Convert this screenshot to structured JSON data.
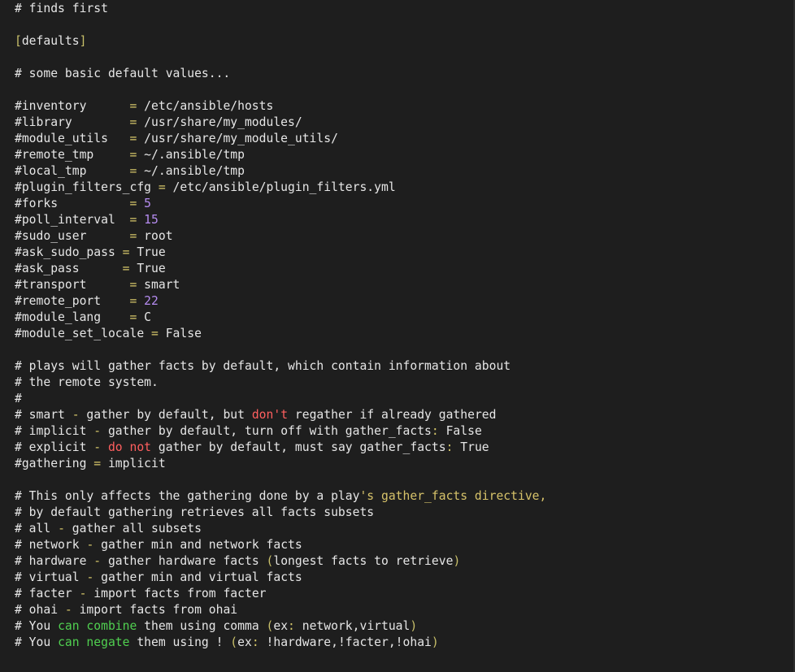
{
  "colors": {
    "background": "#1e1e1e",
    "text": "#e6e6e6",
    "bracket": "#c9c06a",
    "operator": "#d6c76a",
    "number": "#b58cf0",
    "keyword": "#ff5f5f",
    "string": "#d7c36a",
    "green": "#50d050"
  },
  "lines": [
    [
      {
        "t": "# finds first",
        "c": "text"
      }
    ],
    [],
    [
      {
        "t": "[",
        "c": "bracket"
      },
      {
        "t": "defaults",
        "c": "text"
      },
      {
        "t": "]",
        "c": "bracket"
      }
    ],
    [],
    [
      {
        "t": "# some basic default values...",
        "c": "text"
      }
    ],
    [],
    [
      {
        "t": "#inventory      ",
        "c": "text"
      },
      {
        "t": "=",
        "c": "operator"
      },
      {
        "t": " /etc/ansible/hosts",
        "c": "text"
      }
    ],
    [
      {
        "t": "#library        ",
        "c": "text"
      },
      {
        "t": "=",
        "c": "operator"
      },
      {
        "t": " /usr/share/my_modules/",
        "c": "text"
      }
    ],
    [
      {
        "t": "#module_utils   ",
        "c": "text"
      },
      {
        "t": "=",
        "c": "operator"
      },
      {
        "t": " /usr/share/my_module_utils/",
        "c": "text"
      }
    ],
    [
      {
        "t": "#remote_tmp     ",
        "c": "text"
      },
      {
        "t": "=",
        "c": "operator"
      },
      {
        "t": " ~/.ansible/tmp",
        "c": "text"
      }
    ],
    [
      {
        "t": "#local_tmp      ",
        "c": "text"
      },
      {
        "t": "=",
        "c": "operator"
      },
      {
        "t": " ~/.ansible/tmp",
        "c": "text"
      }
    ],
    [
      {
        "t": "#plugin_filters_cfg ",
        "c": "text"
      },
      {
        "t": "=",
        "c": "operator"
      },
      {
        "t": " /etc/ansible/plugin_filters.yml",
        "c": "text"
      }
    ],
    [
      {
        "t": "#forks          ",
        "c": "text"
      },
      {
        "t": "=",
        "c": "operator"
      },
      {
        "t": " ",
        "c": "text"
      },
      {
        "t": "5",
        "c": "number"
      }
    ],
    [
      {
        "t": "#poll_interval  ",
        "c": "text"
      },
      {
        "t": "=",
        "c": "operator"
      },
      {
        "t": " ",
        "c": "text"
      },
      {
        "t": "15",
        "c": "number"
      }
    ],
    [
      {
        "t": "#sudo_user      ",
        "c": "text"
      },
      {
        "t": "=",
        "c": "operator"
      },
      {
        "t": " root",
        "c": "text"
      }
    ],
    [
      {
        "t": "#ask_sudo_pass ",
        "c": "text"
      },
      {
        "t": "=",
        "c": "operator"
      },
      {
        "t": " True",
        "c": "text"
      }
    ],
    [
      {
        "t": "#ask_pass      ",
        "c": "text"
      },
      {
        "t": "=",
        "c": "operator"
      },
      {
        "t": " True",
        "c": "text"
      }
    ],
    [
      {
        "t": "#transport      ",
        "c": "text"
      },
      {
        "t": "=",
        "c": "operator"
      },
      {
        "t": " smart",
        "c": "text"
      }
    ],
    [
      {
        "t": "#remote_port    ",
        "c": "text"
      },
      {
        "t": "=",
        "c": "operator"
      },
      {
        "t": " ",
        "c": "text"
      },
      {
        "t": "22",
        "c": "number"
      }
    ],
    [
      {
        "t": "#module_lang    ",
        "c": "text"
      },
      {
        "t": "=",
        "c": "operator"
      },
      {
        "t": " C",
        "c": "text"
      }
    ],
    [
      {
        "t": "#module_set_locale ",
        "c": "text"
      },
      {
        "t": "=",
        "c": "operator"
      },
      {
        "t": " False",
        "c": "text"
      }
    ],
    [],
    [
      {
        "t": "# plays will gather facts by default, which contain information about",
        "c": "text"
      }
    ],
    [
      {
        "t": "# the remote system.",
        "c": "text"
      }
    ],
    [
      {
        "t": "#",
        "c": "text"
      }
    ],
    [
      {
        "t": "# smart ",
        "c": "text"
      },
      {
        "t": "-",
        "c": "operator"
      },
      {
        "t": " gather by default, but ",
        "c": "text"
      },
      {
        "t": "don't",
        "c": "keyword"
      },
      {
        "t": " regather if already gathered",
        "c": "text"
      }
    ],
    [
      {
        "t": "# implicit ",
        "c": "text"
      },
      {
        "t": "-",
        "c": "operator"
      },
      {
        "t": " gather by default, turn off with gather_facts",
        "c": "text"
      },
      {
        "t": ":",
        "c": "operator"
      },
      {
        "t": " False",
        "c": "text"
      }
    ],
    [
      {
        "t": "# explicit ",
        "c": "text"
      },
      {
        "t": "-",
        "c": "operator"
      },
      {
        "t": " ",
        "c": "text"
      },
      {
        "t": "do not",
        "c": "keyword"
      },
      {
        "t": " gather by default, must say gather_facts",
        "c": "text"
      },
      {
        "t": ":",
        "c": "operator"
      },
      {
        "t": " True",
        "c": "text"
      }
    ],
    [
      {
        "t": "#gathering ",
        "c": "text"
      },
      {
        "t": "=",
        "c": "operator"
      },
      {
        "t": " implicit",
        "c": "text"
      }
    ],
    [],
    [
      {
        "t": "# This only affects the gathering done by a play",
        "c": "text"
      },
      {
        "t": "'s gather_facts directive,",
        "c": "string"
      }
    ],
    [
      {
        "t": "# by default gathering retrieves all facts subsets",
        "c": "text"
      }
    ],
    [
      {
        "t": "# all ",
        "c": "text"
      },
      {
        "t": "-",
        "c": "operator"
      },
      {
        "t": " gather all subsets",
        "c": "text"
      }
    ],
    [
      {
        "t": "# network ",
        "c": "text"
      },
      {
        "t": "-",
        "c": "operator"
      },
      {
        "t": " gather min and network facts",
        "c": "text"
      }
    ],
    [
      {
        "t": "# hardware ",
        "c": "text"
      },
      {
        "t": "-",
        "c": "operator"
      },
      {
        "t": " gather hardware facts ",
        "c": "text"
      },
      {
        "t": "(",
        "c": "bracket"
      },
      {
        "t": "longest facts to retrieve",
        "c": "text"
      },
      {
        "t": ")",
        "c": "bracket"
      }
    ],
    [
      {
        "t": "# virtual ",
        "c": "text"
      },
      {
        "t": "-",
        "c": "operator"
      },
      {
        "t": " gather min and virtual facts",
        "c": "text"
      }
    ],
    [
      {
        "t": "# facter ",
        "c": "text"
      },
      {
        "t": "-",
        "c": "operator"
      },
      {
        "t": " import facts from facter",
        "c": "text"
      }
    ],
    [
      {
        "t": "# ohai ",
        "c": "text"
      },
      {
        "t": "-",
        "c": "operator"
      },
      {
        "t": " import facts from ohai",
        "c": "text"
      }
    ],
    [
      {
        "t": "# You ",
        "c": "text"
      },
      {
        "t": "can combine",
        "c": "green"
      },
      {
        "t": " them using comma ",
        "c": "text"
      },
      {
        "t": "(",
        "c": "bracket"
      },
      {
        "t": "ex",
        "c": "text"
      },
      {
        "t": ":",
        "c": "operator"
      },
      {
        "t": " network,virtual",
        "c": "text"
      },
      {
        "t": ")",
        "c": "bracket"
      }
    ],
    [
      {
        "t": "# You ",
        "c": "text"
      },
      {
        "t": "can negate",
        "c": "green"
      },
      {
        "t": " them using ! ",
        "c": "text"
      },
      {
        "t": "(",
        "c": "bracket"
      },
      {
        "t": "ex",
        "c": "text"
      },
      {
        "t": ":",
        "c": "operator"
      },
      {
        "t": " !hardware,!facter,!ohai",
        "c": "text"
      },
      {
        "t": ")",
        "c": "bracket"
      }
    ]
  ]
}
